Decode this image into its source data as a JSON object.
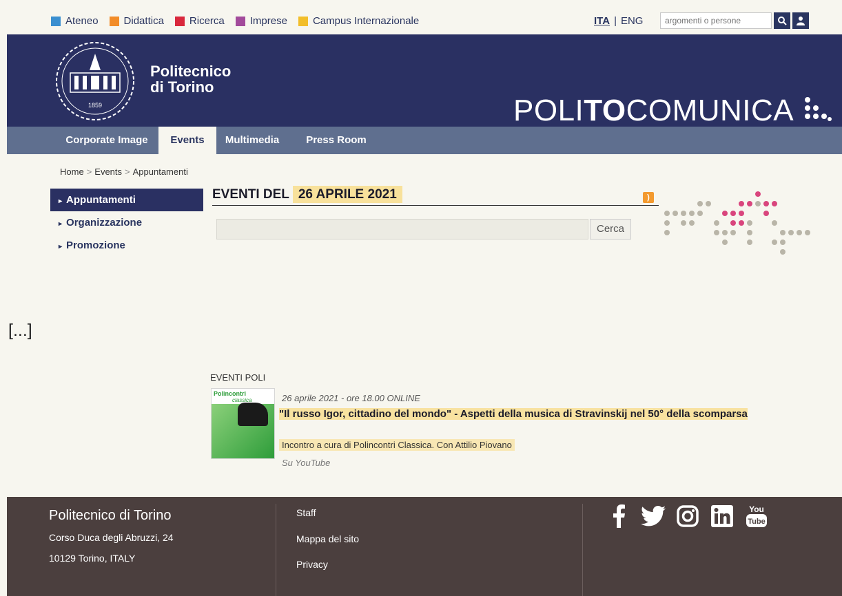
{
  "topnav": {
    "items": [
      {
        "label": "Ateneo",
        "color": "#3a8fd0"
      },
      {
        "label": "Didattica",
        "color": "#f28c28"
      },
      {
        "label": "Ricerca",
        "color": "#d9283c"
      },
      {
        "label": "Imprese",
        "color": "#a24a9b"
      },
      {
        "label": "Campus Internazionale",
        "color": "#f2be2a"
      }
    ],
    "lang_ita": "ITA",
    "lang_sep": "|",
    "lang_eng": "ENG",
    "search_placeholder": "argomenti o persone"
  },
  "header": {
    "seal_year": "1859",
    "name_line1": "Politecnico",
    "name_line2": "di Torino",
    "brand_pre": "POLI",
    "brand_bold": "TO",
    "brand_post": "COMUNICA"
  },
  "mainnav": {
    "tabs": [
      "Corporate Image",
      "Events",
      "Multimedia",
      "Press Room"
    ],
    "active": "Events"
  },
  "breadcrumb": {
    "items": [
      "Home",
      "Events",
      "Appuntamenti"
    ],
    "separator": ">"
  },
  "side_menu": {
    "items": [
      "Appuntamenti",
      "Organizzazione",
      "Promozione"
    ],
    "active": "Appuntamenti"
  },
  "events": {
    "title_prefix": "EVENTI DEL ",
    "title_date": "26 APRILE 2021",
    "search_button": "Cerca",
    "ellipsis": "[...]",
    "category": "EVENTI POLI",
    "item": {
      "thumb_title": "Polincontri",
      "thumb_subtitle": "classica",
      "date": "26 aprile 2021 - ore 18.00 ONLINE",
      "title": "\"Il russo Igor, cittadino del mondo\" - Aspetti della musica di Stravinskij nel 50° della scomparsa",
      "description": "Incontro a cura di Polincontri Classica. Con Attilio Piovano",
      "link": "Su YouTube"
    }
  },
  "footer": {
    "title": "Politecnico di Torino",
    "address1": "Corso Duca degli Abruzzi, 24",
    "address2": "10129 Torino, ITALY",
    "links": [
      "Staff",
      "Mappa del sito",
      "Privacy"
    ],
    "social": [
      "facebook-icon",
      "twitter-icon",
      "instagram-icon",
      "linkedin-icon",
      "youtube-icon"
    ]
  },
  "colors": {
    "navy": "#2a3062",
    "nav_bar": "#5f6f8f",
    "footer": "#4b3f3e",
    "highlight": "#f8dd8c"
  }
}
